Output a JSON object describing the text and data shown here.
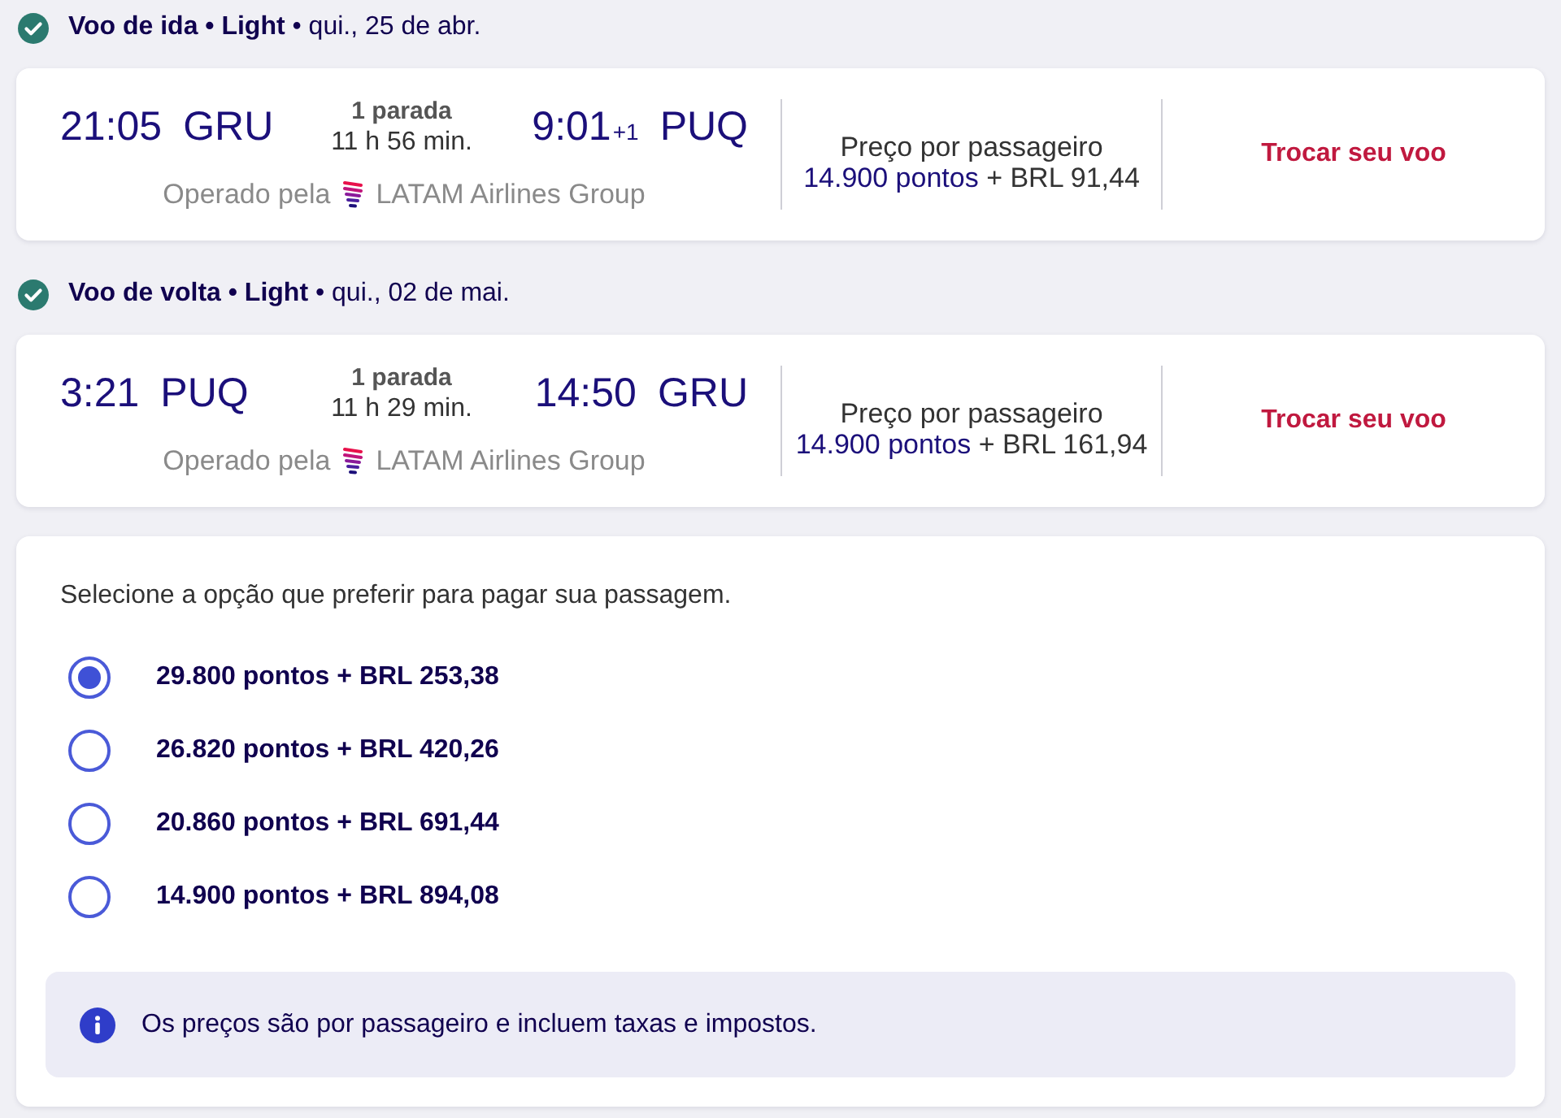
{
  "flights": [
    {
      "heading": "**Voo de ida • Light** • qui., 25 de abr.",
      "departure": {
        "time": "21:05",
        "airport": "GRU"
      },
      "stops": "1 parada",
      "duration": "11 h 56 min.",
      "arrival": {
        "time": "9:01",
        "day_offset": "+1",
        "airport": "PUQ"
      },
      "operated_by": "Operado pela",
      "airline": "LATAM Airlines Group",
      "price_label": "Preço por passageiro",
      "price_points": "14.900 pontos",
      "price_cash": "+ BRL 91,44",
      "action": "Trocar seu voo"
    },
    {
      "heading": "**Voo de volta • Light** • qui., 02 de mai.",
      "departure": {
        "time": "3:21",
        "airport": "PUQ"
      },
      "stops": "1 parada",
      "duration": "11 h 29 min.",
      "arrival": {
        "time": "14:50",
        "airport": "GRU"
      },
      "operated_by": "Operado pela",
      "airline": "LATAM Airlines Group",
      "price_label": "Preço por passageiro",
      "price_points": "14.900 pontos",
      "price_cash": "+ BRL 161,94",
      "action": "Trocar seu voo"
    }
  ],
  "payment": {
    "prompt": "Selecione a opção que preferir para pagar sua passagem.",
    "options": [
      {
        "label": "29.800 pontos + BRL 253,38",
        "selected": true
      },
      {
        "label": "26.820 pontos + BRL 420,26",
        "selected": false
      },
      {
        "label": "20.860 pontos + BRL 691,44",
        "selected": false
      },
      {
        "label": "14.900 pontos + BRL 894,08",
        "selected": false
      }
    ],
    "notice": "Os preços são por passageiro e incluem taxas e impostos."
  }
}
